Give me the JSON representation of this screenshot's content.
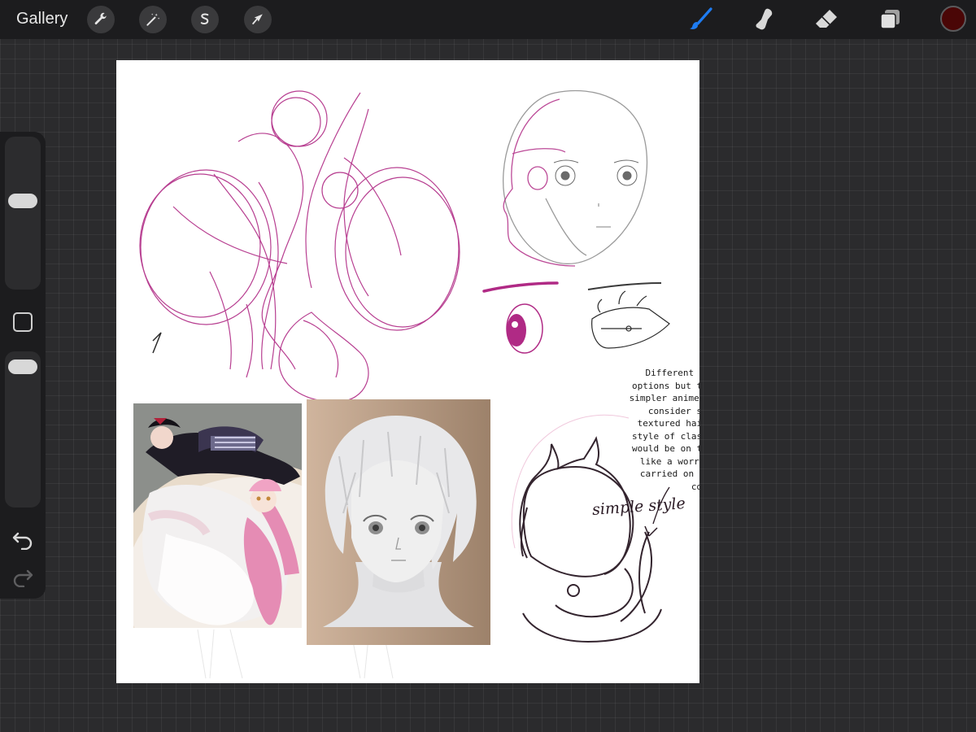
{
  "topbar": {
    "gallery_label": "Gallery",
    "left_tools": [
      "wrench-icon",
      "magic-wand-icon",
      "selection-icon",
      "transform-icon"
    ],
    "right_tools": [
      "brush-icon",
      "smudge-icon",
      "eraser-icon",
      "layers-icon"
    ],
    "active_tool": "brush-icon",
    "accent_color": "#1e7cf2",
    "current_color": "#4a0606"
  },
  "sidebar": {
    "controls": [
      "brush-size-slider",
      "modify-button",
      "opacity-slider",
      "undo-icon",
      "redo-icon"
    ]
  },
  "canvas": {
    "sketch_color": "#b02a85",
    "note_text": "Different face and color options but the hair would be simpler anime styles I want to consider some different textured hair styles in the style of classic anime. These would be on the smaller scale like a worry stone they're carried on ones person for comfort",
    "handwritten_label": "simple style"
  }
}
